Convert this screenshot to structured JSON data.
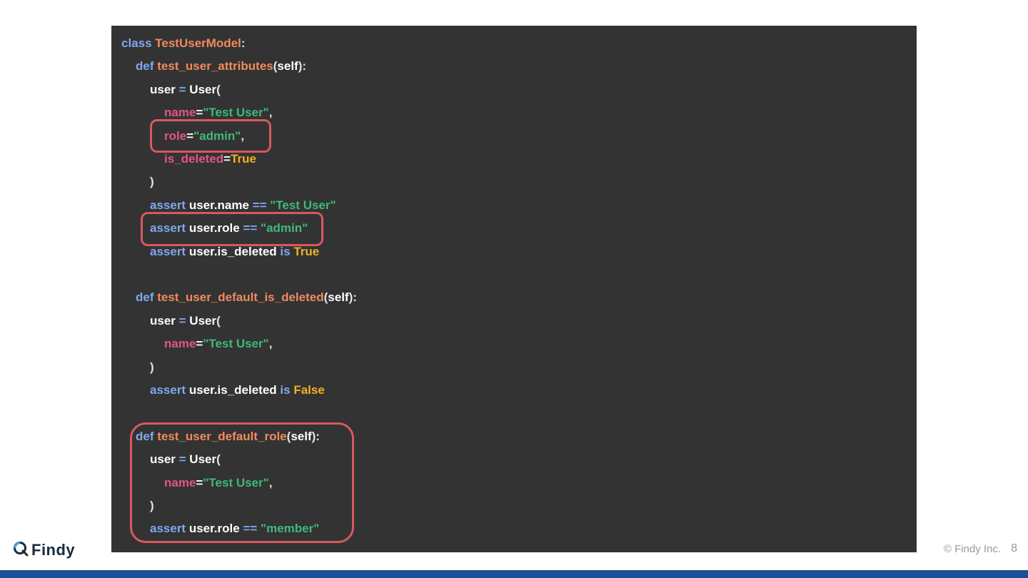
{
  "code": {
    "lines": [
      [
        {
          "t": "kw",
          "v": "class "
        },
        {
          "t": "name",
          "v": "TestUserModel"
        },
        {
          "t": "punct",
          "v": ":"
        }
      ],
      [
        {
          "t": "kw",
          "v": "def "
        },
        {
          "t": "name",
          "v": "test_user_attributes"
        },
        {
          "t": "punct",
          "v": "("
        },
        {
          "t": "plain",
          "v": "self"
        },
        {
          "t": "punct",
          "v": "):"
        }
      ],
      [
        {
          "t": "plain",
          "v": "user "
        },
        {
          "t": "kw",
          "v": "= "
        },
        {
          "t": "plain",
          "v": "User"
        },
        {
          "t": "punct",
          "v": "("
        }
      ],
      [
        {
          "t": "attr",
          "v": "name"
        },
        {
          "t": "plain",
          "v": "="
        },
        {
          "t": "str",
          "v": "\"Test User\""
        },
        {
          "t": "punct",
          "v": ","
        }
      ],
      [
        {
          "t": "attr",
          "v": "role"
        },
        {
          "t": "plain",
          "v": "="
        },
        {
          "t": "str",
          "v": "\"admin\""
        },
        {
          "t": "punct",
          "v": ","
        }
      ],
      [
        {
          "t": "attr",
          "v": "is_deleted"
        },
        {
          "t": "plain",
          "v": "="
        },
        {
          "t": "const",
          "v": "True"
        }
      ],
      [
        {
          "t": "punct",
          "v": ")"
        }
      ],
      [
        {
          "t": "kw",
          "v": "assert "
        },
        {
          "t": "plain",
          "v": "user.name "
        },
        {
          "t": "kw",
          "v": "== "
        },
        {
          "t": "str",
          "v": "\"Test User\""
        }
      ],
      [
        {
          "t": "kw",
          "v": "assert "
        },
        {
          "t": "plain",
          "v": "user.role "
        },
        {
          "t": "kw",
          "v": "== "
        },
        {
          "t": "str",
          "v": "\"admin\""
        }
      ],
      [
        {
          "t": "kw",
          "v": "assert "
        },
        {
          "t": "plain",
          "v": "user.is_deleted "
        },
        {
          "t": "kw",
          "v": "is "
        },
        {
          "t": "const",
          "v": "True"
        }
      ],
      [],
      [
        {
          "t": "kw",
          "v": "def "
        },
        {
          "t": "name",
          "v": "test_user_default_is_deleted"
        },
        {
          "t": "punct",
          "v": "("
        },
        {
          "t": "plain",
          "v": "self"
        },
        {
          "t": "punct",
          "v": "):"
        }
      ],
      [
        {
          "t": "plain",
          "v": "user "
        },
        {
          "t": "kw",
          "v": "= "
        },
        {
          "t": "plain",
          "v": "User"
        },
        {
          "t": "punct",
          "v": "("
        }
      ],
      [
        {
          "t": "attr",
          "v": "name"
        },
        {
          "t": "plain",
          "v": "="
        },
        {
          "t": "str",
          "v": "\"Test User\""
        },
        {
          "t": "punct",
          "v": ","
        }
      ],
      [
        {
          "t": "punct",
          "v": ")"
        }
      ],
      [
        {
          "t": "kw",
          "v": "assert "
        },
        {
          "t": "plain",
          "v": "user.is_deleted "
        },
        {
          "t": "kw",
          "v": "is "
        },
        {
          "t": "const",
          "v": "False"
        }
      ],
      [],
      [
        {
          "t": "kw",
          "v": "def "
        },
        {
          "t": "name",
          "v": "test_user_default_role"
        },
        {
          "t": "punct",
          "v": "("
        },
        {
          "t": "plain",
          "v": "self"
        },
        {
          "t": "punct",
          "v": "):"
        }
      ],
      [
        {
          "t": "plain",
          "v": "user "
        },
        {
          "t": "kw",
          "v": "= "
        },
        {
          "t": "plain",
          "v": "User"
        },
        {
          "t": "punct",
          "v": "("
        }
      ],
      [
        {
          "t": "attr",
          "v": "name"
        },
        {
          "t": "plain",
          "v": "="
        },
        {
          "t": "str",
          "v": "\"Test User\""
        },
        {
          "t": "punct",
          "v": ","
        }
      ],
      [
        {
          "t": "punct",
          "v": ")"
        }
      ],
      [
        {
          "t": "kw",
          "v": "assert "
        },
        {
          "t": "plain",
          "v": "user.role "
        },
        {
          "t": "kw",
          "v": "== "
        },
        {
          "t": "str",
          "v": "\"member\""
        }
      ]
    ]
  },
  "colors": {
    "panel_bg": "#333333",
    "keyword": "#7fa8f0",
    "function_name": "#f08a5f",
    "attribute": "#e2558c",
    "string": "#3fb97a",
    "constant": "#f0b21e",
    "highlight": "#d9585f",
    "brand_bar": "#1b4f99"
  },
  "footer": {
    "logo_text": "Findy",
    "logo_icon": "findy-q-icon",
    "copyright": "© Findy Inc.",
    "page_number": "8"
  }
}
